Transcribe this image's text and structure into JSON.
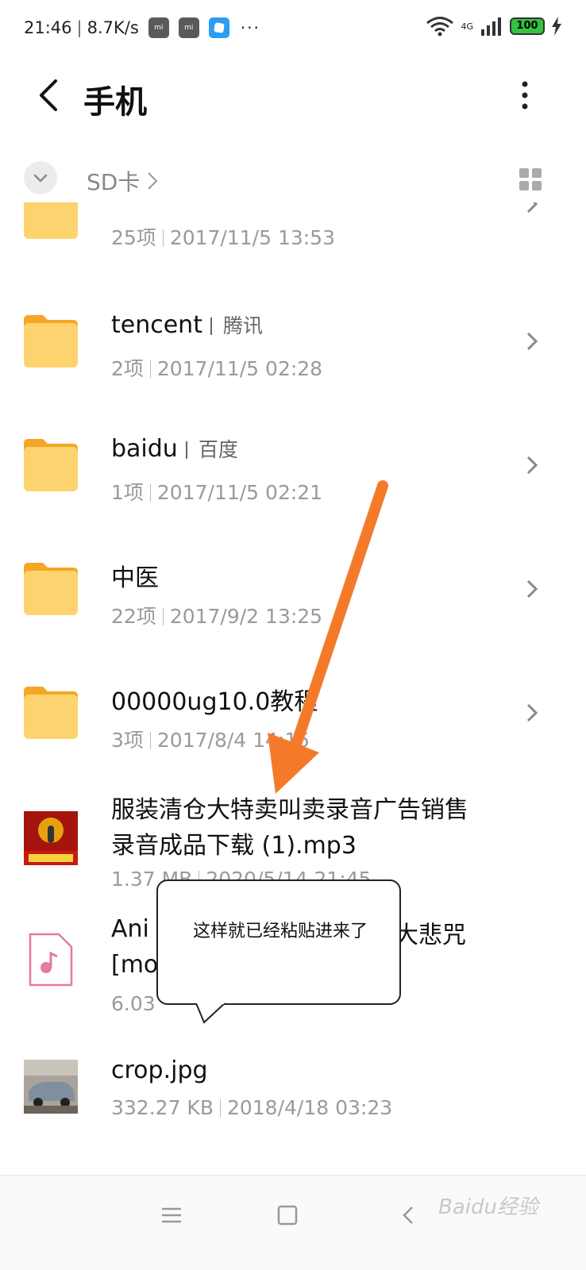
{
  "status_bar": {
    "time": "21:46",
    "speed": "8.7K/s",
    "network": "4G",
    "battery": "100"
  },
  "header": {
    "title": "手机"
  },
  "path": {
    "current": "SD卡"
  },
  "items": [
    {
      "name": "",
      "alias": "",
      "meta_count": "25项",
      "meta_date": "2017/11/5 13:53",
      "type": "folder"
    },
    {
      "name": "tencent",
      "alias": "腾讯",
      "meta_count": "2项",
      "meta_date": "2017/11/5 02:28",
      "type": "folder"
    },
    {
      "name": "baidu",
      "alias": "百度",
      "meta_count": "1项",
      "meta_date": "2017/11/5 02:21",
      "type": "folder"
    },
    {
      "name": "中医",
      "alias": "",
      "meta_count": "22项",
      "meta_date": "2017/9/2 13:25",
      "type": "folder"
    },
    {
      "name": "00000ug10.0教程",
      "alias": "",
      "meta_count": "3项",
      "meta_date": "2017/8/4 14:15",
      "type": "folder"
    },
    {
      "name_line1": "服装清仓大特卖叫卖录音广告销售",
      "name_line2": "录音成品下载 (1).mp3",
      "meta_count": "1.37 MB",
      "meta_date": "2020/5/14 21:45",
      "type": "audio-thumb"
    },
    {
      "name_line1": "Ani",
      "name_line1_tail": "大悲咒",
      "name_line2": "[mo",
      "meta_count": "6.03",
      "meta_date": "",
      "type": "music-file"
    },
    {
      "name": "crop.jpg",
      "meta_count": "332.27 KB",
      "meta_date": "2018/4/18 03:23",
      "type": "image"
    }
  ],
  "callout": {
    "text": "这样就已经粘贴进来了"
  },
  "watermark": "Baidu经验",
  "colors": {
    "folder": "#fcd36e",
    "folder_tab": "#f5a623",
    "arrow": "#f47a2a",
    "battery": "#35c23f"
  }
}
